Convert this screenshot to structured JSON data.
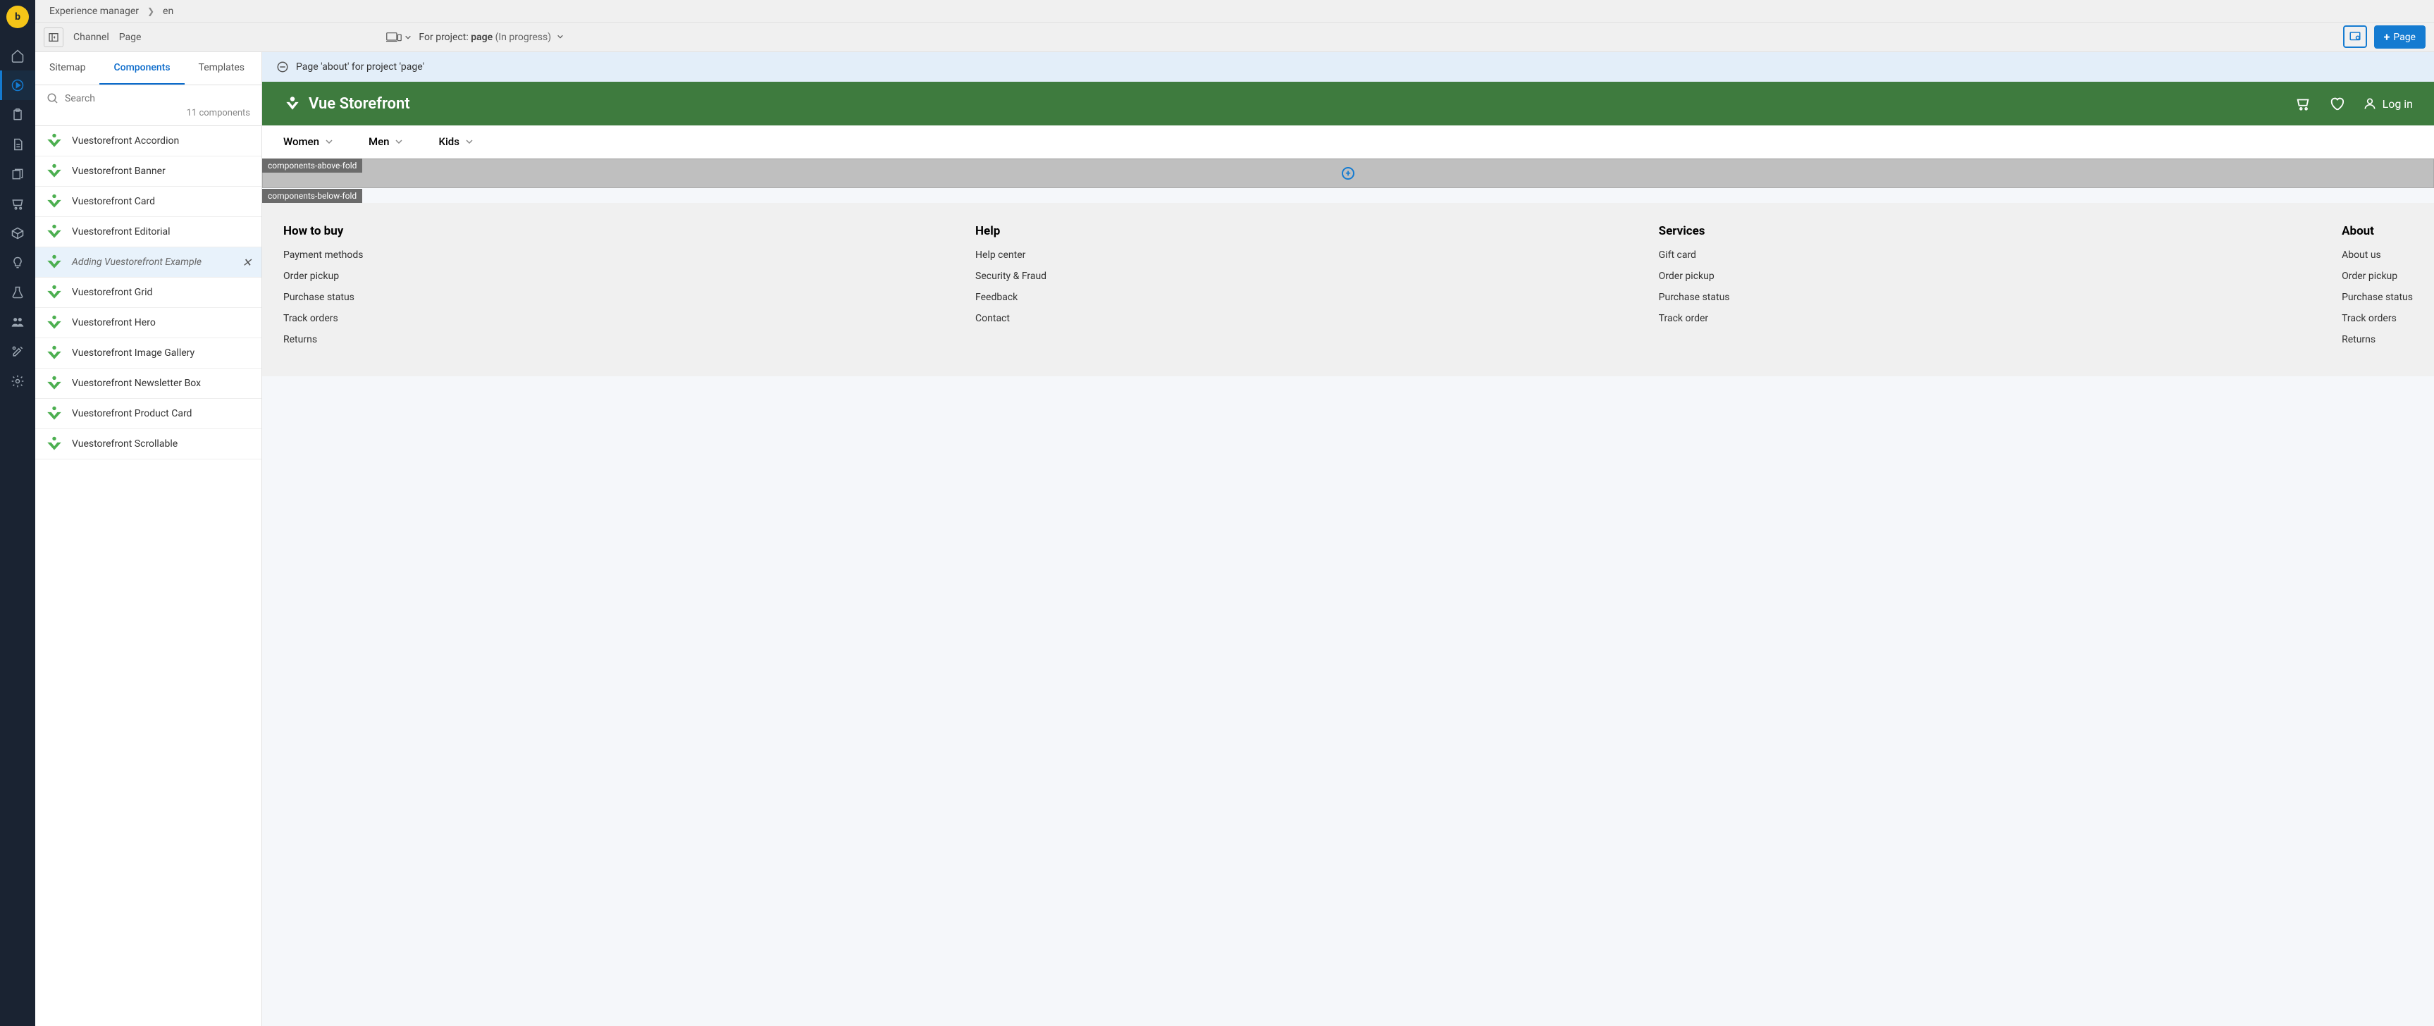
{
  "rail": {
    "logo": "b"
  },
  "breadcrumb": {
    "root": "Experience manager",
    "locale": "en"
  },
  "toolbar": {
    "channel": "Channel",
    "page": "Page",
    "for_project": "For project:",
    "project_name": "page",
    "project_status": "(In progress)",
    "add_page": "Page"
  },
  "sidebar": {
    "tabs": [
      "Sitemap",
      "Components",
      "Templates"
    ],
    "active_tab": 1,
    "search_placeholder": "Search",
    "count": "11 components",
    "components": [
      {
        "label": "Vuestorefront Accordion"
      },
      {
        "label": "Vuestorefront Banner"
      },
      {
        "label": "Vuestorefront Card"
      },
      {
        "label": "Vuestorefront Editorial"
      },
      {
        "label": "Adding Vuestorefront Example",
        "highlight": true,
        "closable": true
      },
      {
        "label": "Vuestorefront Grid"
      },
      {
        "label": "Vuestorefront Hero"
      },
      {
        "label": "Vuestorefront Image Gallery"
      },
      {
        "label": "Vuestorefront Newsletter Box"
      },
      {
        "label": "Vuestorefront Product Card"
      },
      {
        "label": "Vuestorefront Scrollable"
      }
    ]
  },
  "preview": {
    "info": "Page 'about' for project 'page'",
    "brand": "Vue Storefront",
    "login": "Log in",
    "nav": [
      "Women",
      "Men",
      "Kids"
    ],
    "zone_above": "components-above-fold",
    "zone_below": "components-below-fold",
    "footer": [
      {
        "title": "How to buy",
        "links": [
          "Payment methods",
          "Order pickup",
          "Purchase status",
          "Track orders",
          "Returns"
        ]
      },
      {
        "title": "Help",
        "links": [
          "Help center",
          "Security & Fraud",
          "Feedback",
          "Contact"
        ]
      },
      {
        "title": "Services",
        "links": [
          "Gift card",
          "Order pickup",
          "Purchase status",
          "Track order"
        ]
      },
      {
        "title": "About",
        "links": [
          "About us",
          "Order pickup",
          "Purchase status",
          "Track orders",
          "Returns"
        ]
      }
    ]
  }
}
